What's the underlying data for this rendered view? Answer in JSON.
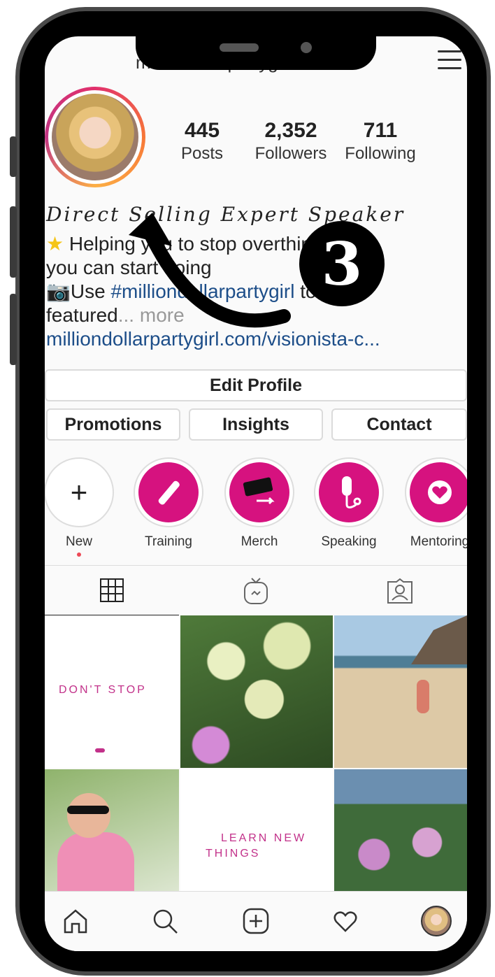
{
  "header": {
    "username": "millondollarpartyg"
  },
  "stats": [
    {
      "num": "445",
      "label": "Posts"
    },
    {
      "num": "2,352",
      "label": "Followers"
    },
    {
      "num": "711",
      "label": "Following"
    }
  ],
  "bio": {
    "title": "Direct Selling Expert Speaker",
    "line1": "Helping you to stop overthinking so",
    "line2": "you can start doing",
    "line3_prefix": "Use ",
    "hashtag": "#milliondollarpartygirl",
    "line3_suffix": " to get",
    "line4": "featured",
    "more": "... more",
    "link": "milliondollarpartygirl.com/visionista-c..."
  },
  "buttons": {
    "edit_profile": "Edit Profile",
    "promotions": "Promotions",
    "insights": "Insights",
    "contact": "Contact"
  },
  "highlights": [
    {
      "label": "New",
      "icon": "plus-icon"
    },
    {
      "label": "Training",
      "icon": "wand-icon"
    },
    {
      "label": "Merch",
      "icon": "merch-icon"
    },
    {
      "label": "Speaking",
      "icon": "microphone-icon"
    },
    {
      "label": "Mentoring",
      "icon": "heart-icon"
    }
  ],
  "grid": {
    "post1_text": "DON'T STOP",
    "post5_line1": "LEARN NEW",
    "post5_line2": "THINGS"
  },
  "annotation": {
    "step_number": "3"
  },
  "colors": {
    "accent": "#d6127f",
    "link": "#1d4e89"
  }
}
